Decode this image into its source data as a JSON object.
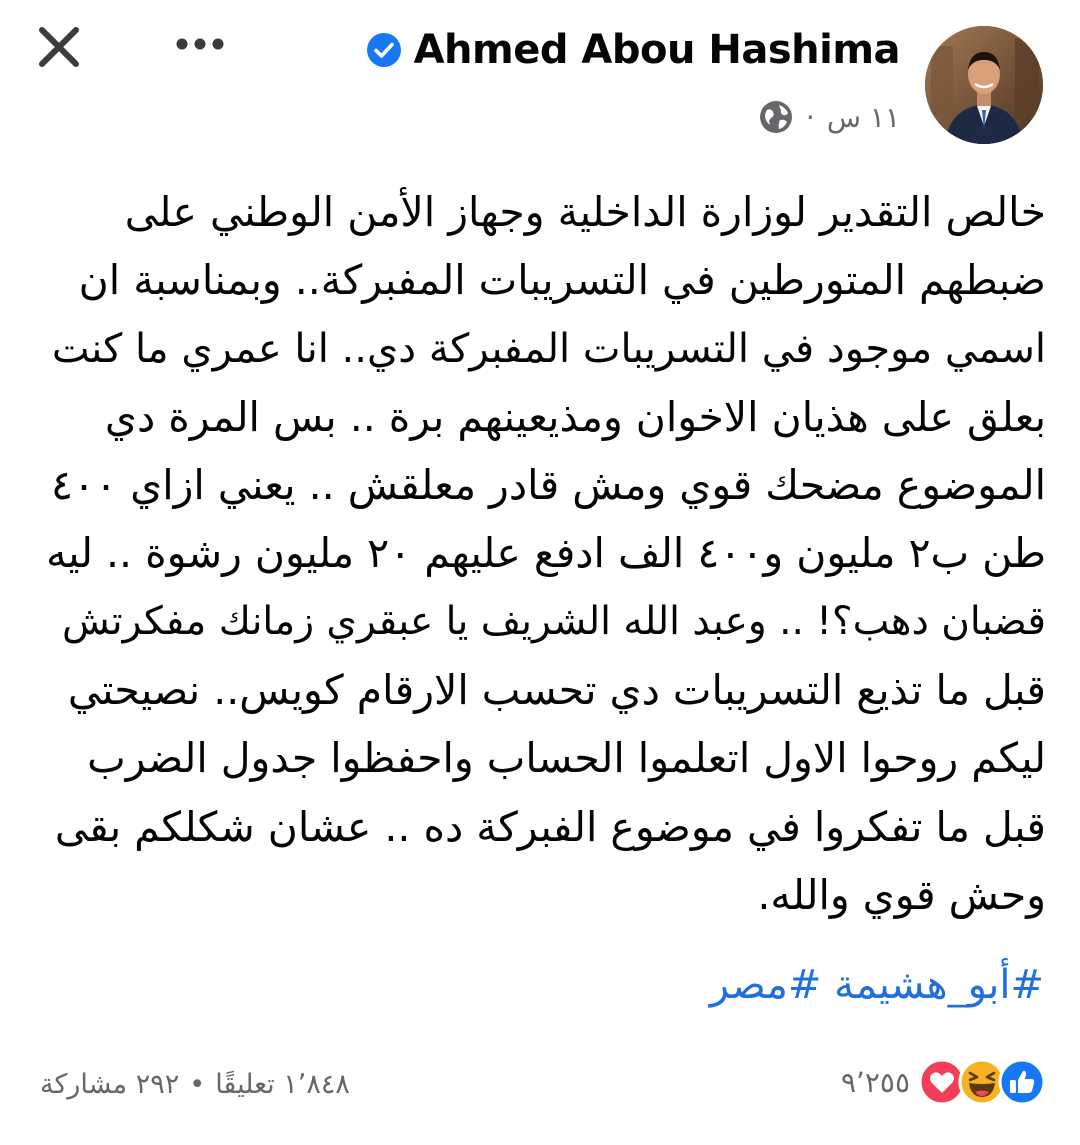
{
  "header": {
    "author_name": "Ahmed Abou Hashima",
    "post_time": "١١ س",
    "meta_separator": "·",
    "close_icon": "close-icon",
    "more_icon": "more-options-icon",
    "verified_icon": "verified-badge-icon",
    "privacy_icon": "globe-icon"
  },
  "post": {
    "lines": [
      "خالص التقدير لوزارة الداخلية وجهاز الأمن الوطني على",
      "ضبطهم المتورطين في التسريبات المفبركة.. وبمناسبة ان",
      "اسمي موجود في التسريبات المفبركة دي.. انا عمري ما كنت",
      "بعلق على هذيان الاخوان ومذيعينهم برة .. بس المرة دي",
      "الموضوع مضحك قوي ومش قادر معلقش ..  يعني ازاي ٤٠٠",
      "طن ب٢ مليون و٤٠٠ الف ادفع عليهم ٢٠ مليون رشوة .. ليه",
      "قضبان دهب؟! .. وعبد الله الشريف يا عبقري زمانك مفكرتش",
      "قبل ما تذيع التسريبات دي تحسب الارقام كويس..  نصيحتي",
      "ليكم روحوا الاول اتعلموا الحساب واحفظوا جدول الضرب",
      "قبل ما تفكروا في موضوع الفبركة ده .. عشان شكلكم بقى",
      "وحش قوي والله."
    ],
    "hashtags": [
      "#أبو_هشيمة",
      "#مصر"
    ]
  },
  "footer": {
    "reaction_count": "٩٬٢٥٥",
    "reaction_icons": [
      "like-icon",
      "haha-icon",
      "love-icon"
    ],
    "comments": "١٬٨٤٨ تعليقًا",
    "separator": "•",
    "shares": "٢٩٢ مشاركة"
  },
  "colors": {
    "text": "#050505",
    "secondary": "#65676b",
    "link": "#216fdb",
    "verified": "#1877f2",
    "like": "#1877f2",
    "love": "#f33e58",
    "haha": "#f7b125"
  }
}
